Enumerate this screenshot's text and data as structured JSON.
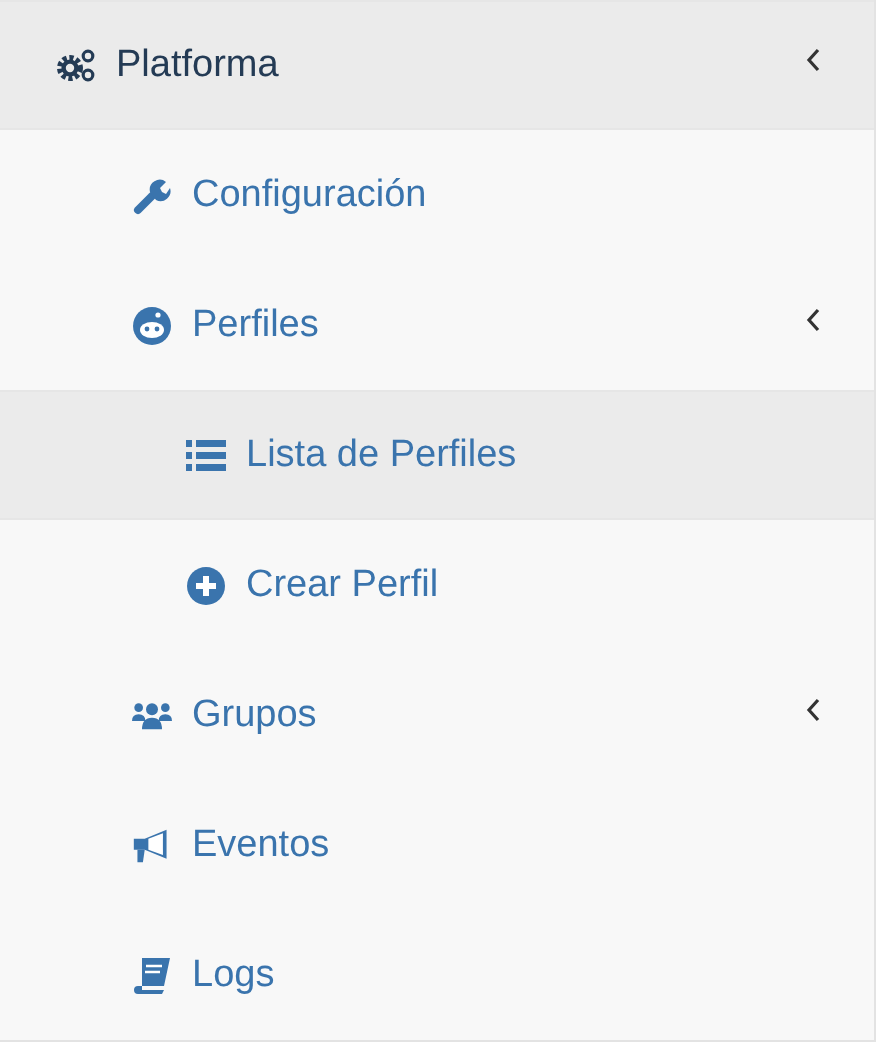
{
  "menu": [
    {
      "label": "Platforma",
      "selected": true,
      "expandable": true,
      "children": [
        {
          "label": "Configuración",
          "selected": false,
          "expandable": false
        },
        {
          "label": "Perfiles",
          "selected": false,
          "expandable": true,
          "children": [
            {
              "label": "Lista de Perfiles",
              "selected": true,
              "expandable": false
            },
            {
              "label": "Crear Perfil",
              "selected": false,
              "expandable": false
            }
          ]
        },
        {
          "label": "Grupos",
          "selected": false,
          "expandable": true
        },
        {
          "label": "Eventos",
          "selected": false,
          "expandable": false
        },
        {
          "label": "Logs",
          "selected": false,
          "expandable": false
        }
      ]
    }
  ]
}
